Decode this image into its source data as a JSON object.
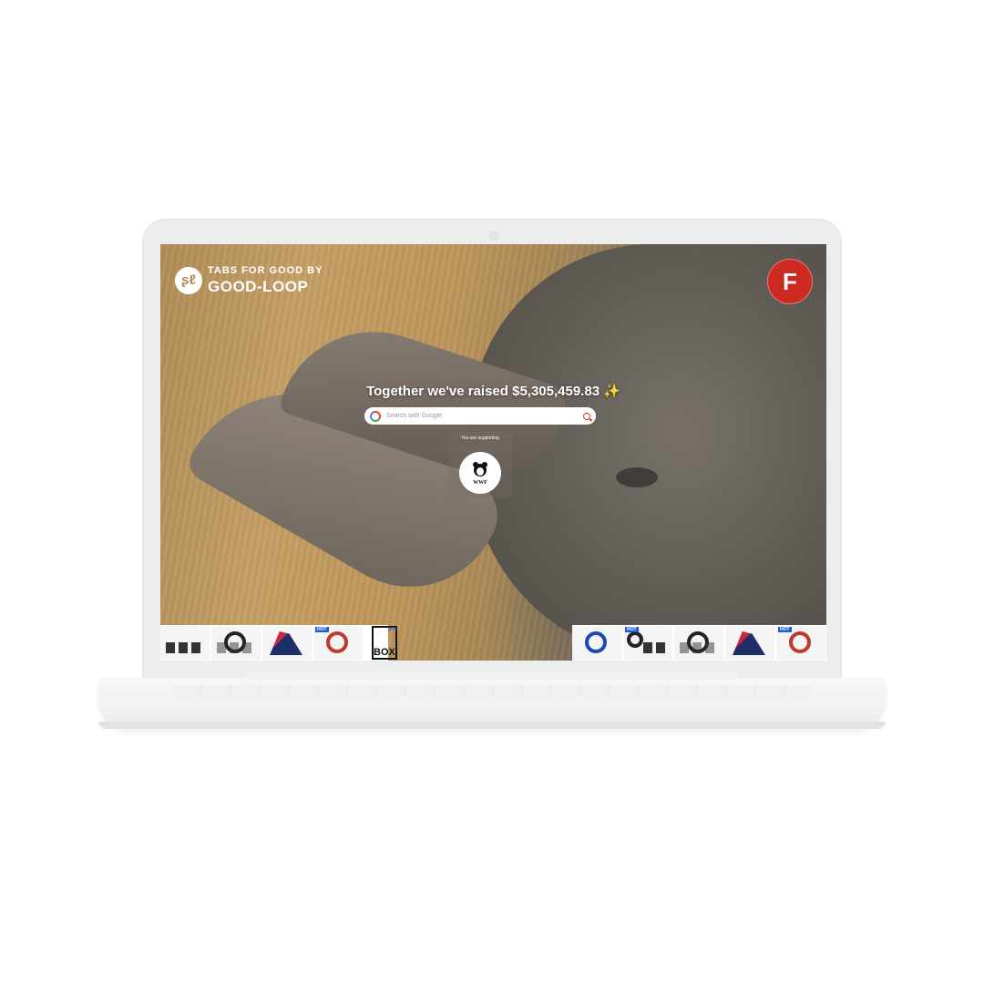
{
  "brand": {
    "line1": "TABS FOR GOOD BY",
    "line2": "GOOD-LOOP",
    "logo_glyph": "ʂℓ"
  },
  "profile": {
    "initial": "F",
    "color": "#cc2a20"
  },
  "headline": {
    "text": "Together we've raised $5,305,459.83",
    "sparkle": "✨"
  },
  "search": {
    "placeholder": "Search with Google",
    "value": ""
  },
  "charity": {
    "label": "You are supporting",
    "name": "WWF"
  },
  "ads": {
    "left": [
      {
        "kind": "pedals"
      },
      {
        "kind": "wheel"
      },
      {
        "kind": "seat"
      },
      {
        "kind": "wheel",
        "badge": "HOT"
      }
    ],
    "left_brand": "BOX",
    "right": [
      {
        "kind": "wheel",
        "variant": "blue"
      },
      {
        "kind": "pedals",
        "badge": "HOT"
      },
      {
        "kind": "wheel"
      },
      {
        "kind": "seat"
      },
      {
        "kind": "wheel",
        "badge": "HOT"
      }
    ],
    "adchoices_icon": "adchoices-icon"
  }
}
